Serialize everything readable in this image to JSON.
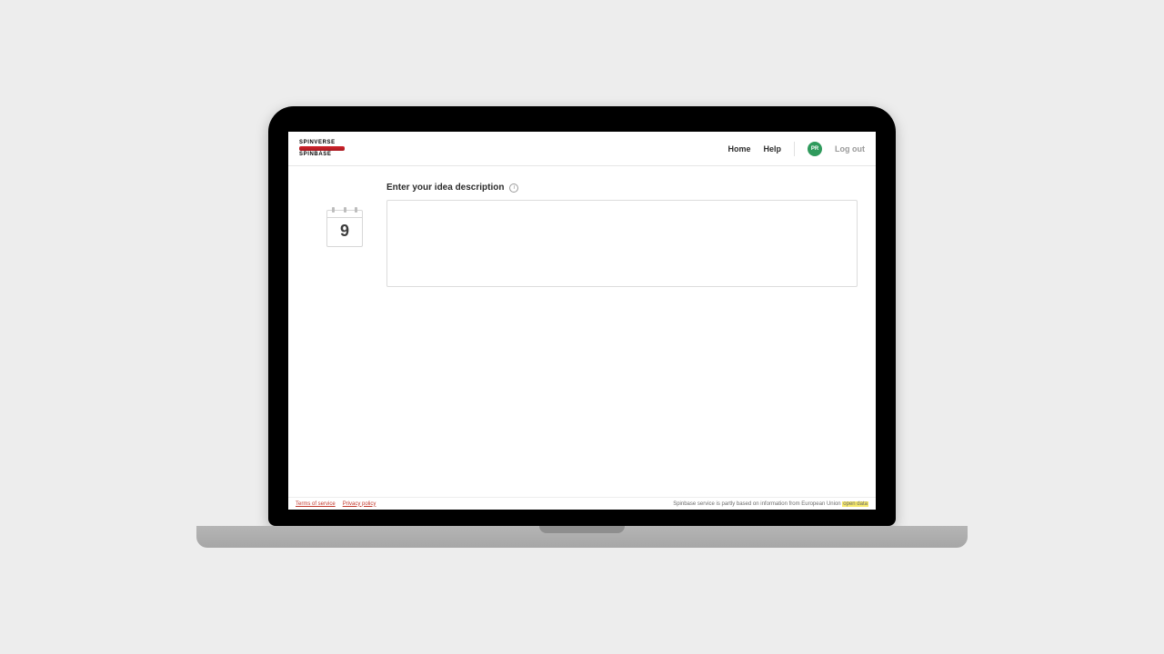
{
  "logo": {
    "top": "SPINVERSE",
    "bottom": "SPINBASE"
  },
  "nav": {
    "home": "Home",
    "help": "Help",
    "avatar": "PR",
    "logout": "Log out"
  },
  "calendar": {
    "day": "9"
  },
  "form": {
    "label": "Enter your idea description",
    "value": ""
  },
  "footer": {
    "terms": "Terms of service",
    "privacy": "Privacy policy",
    "note_prefix": "Spinbase service is partly based on information from European Union ",
    "note_highlight": "open data"
  }
}
